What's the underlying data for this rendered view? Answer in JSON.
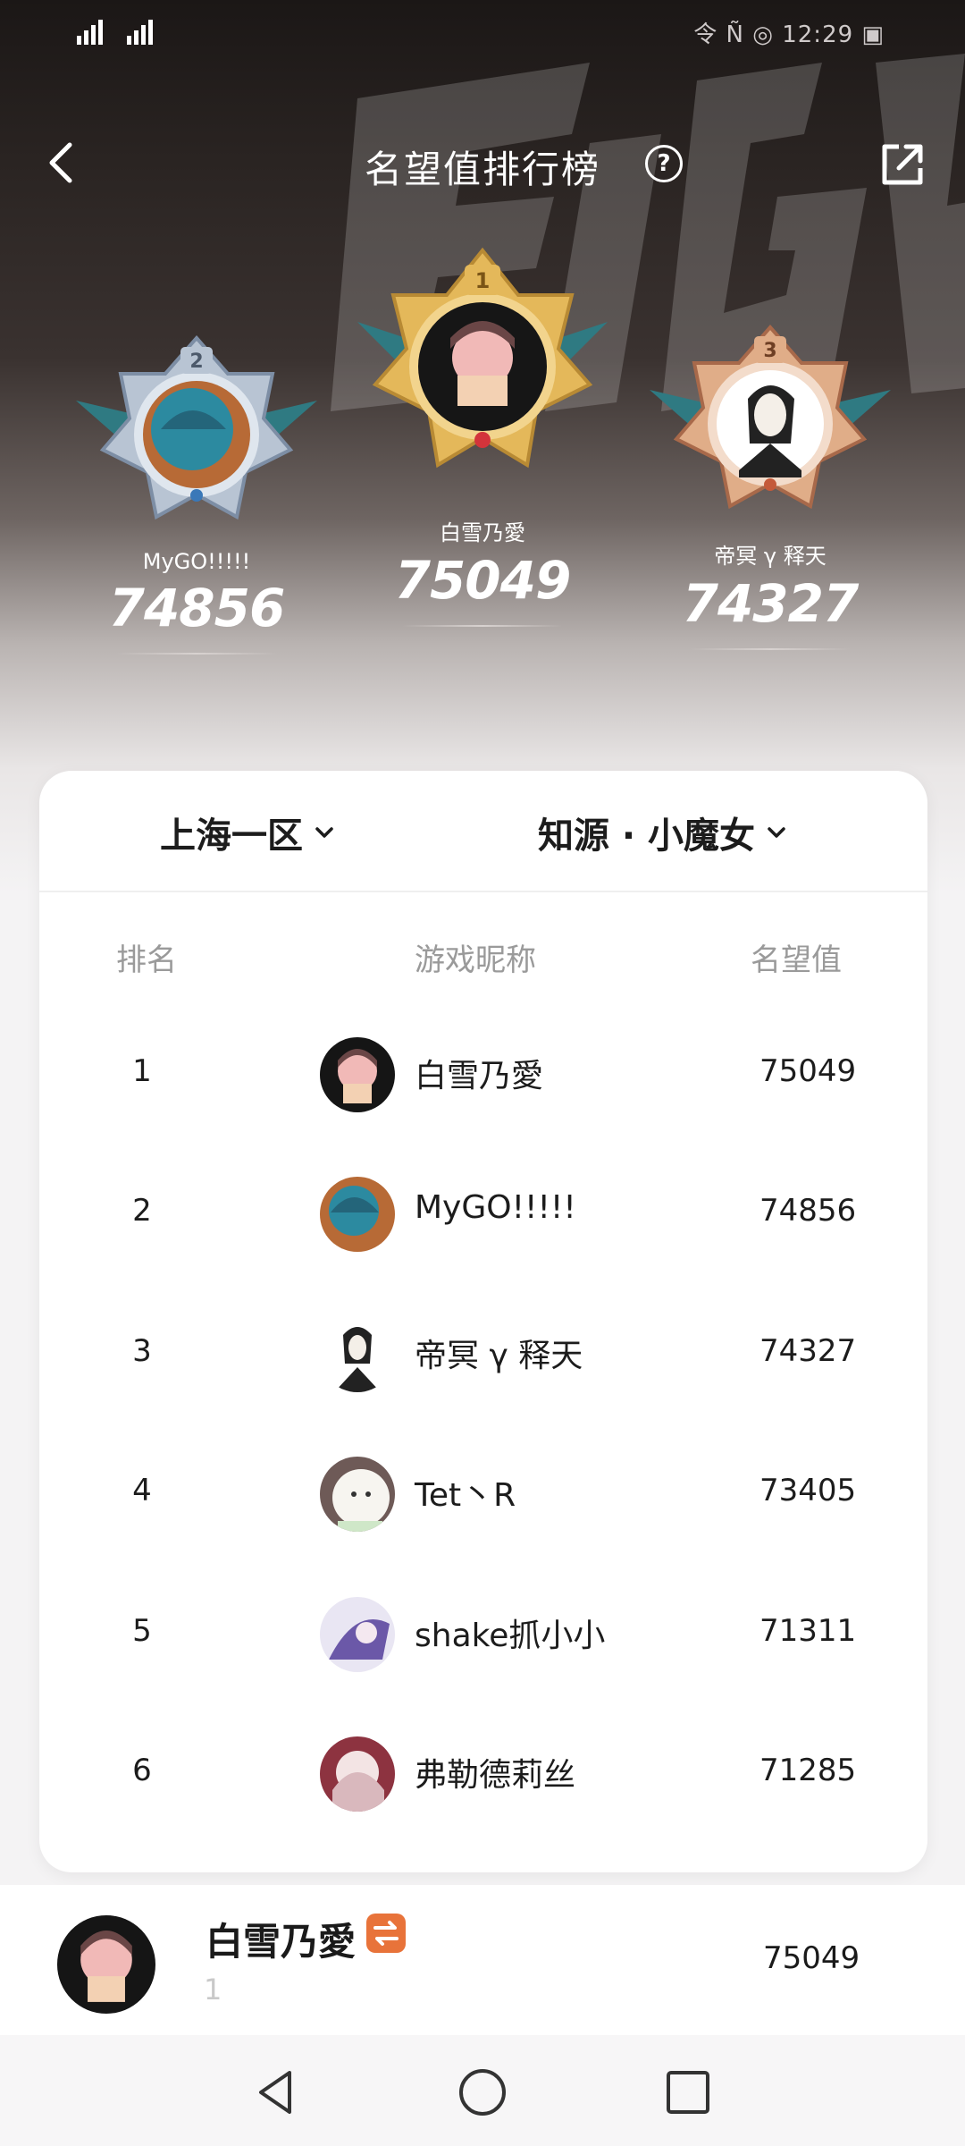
{
  "status_bar": {
    "left": "5G 4G",
    "right": "令 Ñ ◎ 12:29 ▣"
  },
  "header": {
    "title": "名望值排行榜",
    "help": "?"
  },
  "podium": [
    {
      "rank": "1",
      "name": "白雪乃愛",
      "score": "75049",
      "medal": "gold"
    },
    {
      "rank": "2",
      "name": "MyGO!!!!!",
      "score": "74856",
      "medal": "silver"
    },
    {
      "rank": "3",
      "name": "帝冥 γ 释天",
      "score": "74327",
      "medal": "bronze"
    }
  ],
  "filters": {
    "server": "上海一区",
    "role": "知源 · 小魔女"
  },
  "columns": {
    "rank": "排名",
    "nickname": "游戏昵称",
    "value": "名望值"
  },
  "rows": [
    {
      "rank": "1",
      "nickname": "白雪乃愛",
      "value": "75049"
    },
    {
      "rank": "2",
      "nickname": "MyGO!!!!!",
      "value": "74856"
    },
    {
      "rank": "3",
      "nickname": "帝冥 γ 释天",
      "value": "74327"
    },
    {
      "rank": "4",
      "nickname": "Tet丶R",
      "value": "73405"
    },
    {
      "rank": "5",
      "nickname": "shake抓小小",
      "value": "71311"
    },
    {
      "rank": "6",
      "nickname": "弗勒德莉丝",
      "value": "71285"
    }
  ],
  "my_entry": {
    "name": "白雪乃愛",
    "rank": "1",
    "value": "75049"
  },
  "colors": {
    "gold": "#e4b85a",
    "silver": "#a9b7c9",
    "bronze": "#d9a07c",
    "tag": "#e8733a"
  }
}
